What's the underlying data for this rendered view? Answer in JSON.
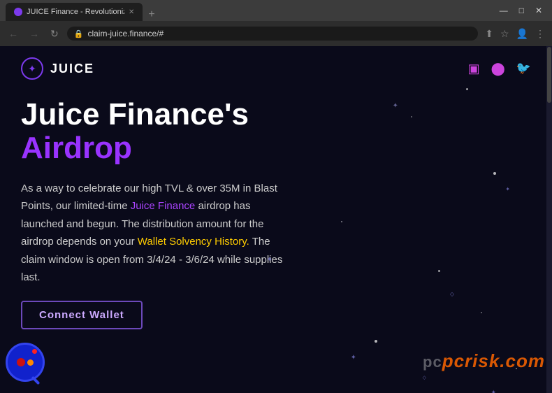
{
  "browser": {
    "tab_title": "JUICE Finance - Revolutionizing ...",
    "tab_favicon": "●",
    "tab_close": "✕",
    "new_tab_btn": "+",
    "window_controls": [
      "—",
      "□",
      "✕"
    ],
    "address": "claim-juice.finance/#",
    "lock_icon": "🔒",
    "nav_back": "←",
    "nav_forward": "→",
    "nav_reload": "↺",
    "toolbar_share": "⬆",
    "toolbar_star": "☆",
    "toolbar_profile": "👤",
    "toolbar_more": "⋮"
  },
  "site": {
    "logo_text": "JUICE",
    "logo_icon": "✦",
    "nav_icons": [
      "▣",
      "⬤",
      "🐦"
    ],
    "headline_line1": "Juice Finance's",
    "headline_line2": "Airdrop",
    "body_text_1": "As a way to celebrate our high TVL & over 35M in Blast Points, our limited-time ",
    "body_link1": "Juice Finance",
    "body_text_2": " airdrop has launched and begun. The distribution amount for the airdrop depends on your ",
    "body_link2": "Wallet Solvency History.",
    "body_text_3": " The claim window is open from 3/4/24 - 3/6/24 while supplies last.",
    "connect_btn": "Connect Wallet",
    "watermark": "pcrisk.com",
    "colors": {
      "accent_purple": "#9933ff",
      "accent_yellow": "#ffcc00",
      "background": "#0a0a1a"
    }
  }
}
